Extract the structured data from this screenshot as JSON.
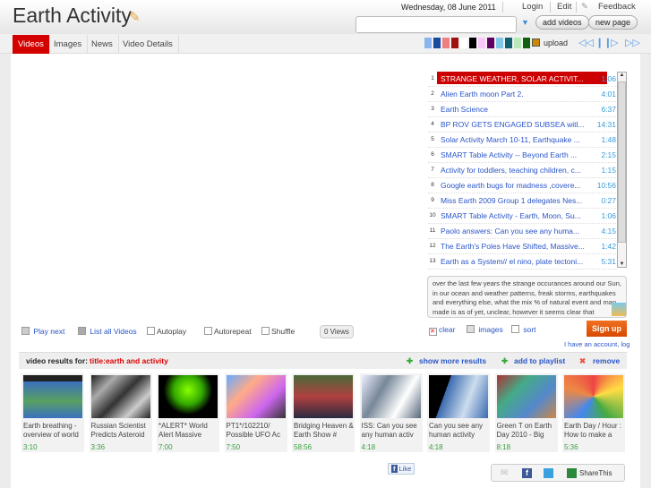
{
  "header": {
    "title": "Earth Activity",
    "date": "Wednesday, 08 June 2011",
    "login": "Login",
    "edit": "Edit",
    "feedback": "Feedback",
    "add_videos": "add videos",
    "new_page": "new page",
    "search_value": ""
  },
  "tabs": [
    {
      "label": "Videos",
      "active": true
    },
    {
      "label": "Images"
    },
    {
      "label": "News"
    },
    {
      "label": "Video Details"
    }
  ],
  "toolbar": {
    "upload": "upload",
    "swatches": [
      "#8ab4f0",
      "#1a4aa0",
      "#f08080",
      "#a01010",
      "#ffffff",
      "#000000",
      "#f8c8f8",
      "#600060",
      "#80c8e8",
      "#106070",
      "#b8e8b8",
      "#106010"
    ]
  },
  "playlist": [
    {
      "n": "1",
      "title": "STRANGE WEATHER, SOLAR ACTIVIT...",
      "dur": "1:06",
      "active": true
    },
    {
      "n": "2",
      "title": "Alien Earth moon Part 2.",
      "dur": "4:01"
    },
    {
      "n": "3",
      "title": "Earth Science",
      "dur": "6:37"
    },
    {
      "n": "4",
      "title": "BP ROV GETS ENGAGED SUBSEA witl...",
      "dur": "14:31"
    },
    {
      "n": "5",
      "title": "Solar Activity March 10-11, Earthquake ...",
      "dur": "1:48"
    },
    {
      "n": "6",
      "title": "SMART Table Activity -- Beyond Earth ...",
      "dur": "2:15"
    },
    {
      "n": "7",
      "title": "Activity for toddlers, teaching children, c...",
      "dur": "1:15"
    },
    {
      "n": "8",
      "title": "Google earth bugs for madness ,covere...",
      "dur": "10:56"
    },
    {
      "n": "9",
      "title": "Miss Earth 2009 Group 1 delegates Nes...",
      "dur": "0:27"
    },
    {
      "n": "10",
      "title": "SMART Table Activity - Earth, Moon, Su...",
      "dur": "1:06"
    },
    {
      "n": "11",
      "title": "Paolo answers: Can you see any huma...",
      "dur": "4:15"
    },
    {
      "n": "12",
      "title": "The Earth's Poles Have Shifted, Massive...",
      "dur": "1:42"
    },
    {
      "n": "13",
      "title": "Earth as a System// el nino, plate tectoni...",
      "dur": "5:31"
    }
  ],
  "description": "over the last few years the strange occurances around our Sun, in our ocean and weather patterns, freak storms, earthquakes and everything else, what the mix % of natural event and man made is as of yet, unclear, however it seems clear that",
  "controls": {
    "play_next": "Play next",
    "list_all": "List all Videos",
    "autoplay": "Autoplay",
    "autorepeat": "Autorepeat",
    "shuffle": "Shuffle",
    "views": "0 Views",
    "clear": "clear",
    "images": "images",
    "sort": "sort",
    "signup": "Sign up",
    "account": "I have an account, log"
  },
  "results": {
    "label": "video results for:",
    "query": "title:earth and activity",
    "show_more": "show more results",
    "add_playlist": "add to playlist",
    "remove": "remove"
  },
  "thumbs": [
    {
      "title": "Earth breathing - overview of world",
      "dur": "3:10",
      "bg": "linear-gradient(#222 15%,#3a70c0 15%,#58a060 60%,#3a70c0)"
    },
    {
      "title": "Russian Scientist Predicts Asteroid",
      "dur": "3:36",
      "bg": "linear-gradient(135deg,#222,#aaa,#333,#ccc,#222)"
    },
    {
      "title": "*ALERT* World Alert Massive",
      "dur": "7:00",
      "bg": "radial-gradient(circle at 50% 35%,#8f0 0,#3a0 35%,#000 60%)"
    },
    {
      "title": "PT1*/102210/ Possible UFO Ac",
      "dur": "7:50",
      "bg": "linear-gradient(135deg,#6af,#fa8,#c6e,#333)"
    },
    {
      "title": "Bridging Heaven & Earth Show #",
      "dur": "58:56",
      "bg": "linear-gradient(#4a6a3a,#b04040,#2a2a40)"
    },
    {
      "title": "ISS: Can you see any human activ",
      "dur": "4:18",
      "bg": "linear-gradient(120deg,#eef,#789,#fff,#567)"
    },
    {
      "title": "Can you see any human activity",
      "dur": "4:18",
      "bg": "linear-gradient(110deg,#000 30%,#3a6ab0 30%,#cde,#3a6ab0)"
    },
    {
      "title": "Green T on Earth Day 2010 - Big",
      "dur": "8:18",
      "bg": "linear-gradient(135deg,#a33,#4a8,#58c,#c84)"
    },
    {
      "title": "Earth Day / Hour : How to make a",
      "dur": "5:36",
      "bg": "conic-gradient(#e44,#fd4,#4a4,#48e,#e84,#e44)"
    }
  ],
  "social": {
    "like": "Like",
    "share": "ShareThis"
  }
}
